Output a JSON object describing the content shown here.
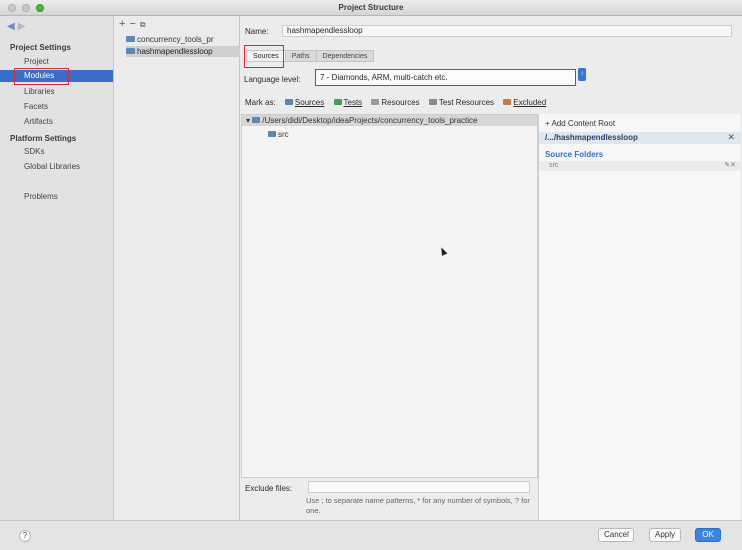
{
  "window": {
    "title": "Project Structure"
  },
  "sidebar": {
    "section_project": "Project Settings",
    "items_project": [
      {
        "label": "Project"
      },
      {
        "label": "Modules",
        "selected": true
      },
      {
        "label": "Libraries"
      },
      {
        "label": "Facets"
      },
      {
        "label": "Artifacts"
      }
    ],
    "section_platform": "Platform Settings",
    "items_platform": [
      {
        "label": "SDKs"
      },
      {
        "label": "Global Libraries"
      }
    ],
    "problems": "Problems"
  },
  "modules": {
    "items": [
      {
        "label": "concurrency_tools_pr"
      },
      {
        "label": "hashmapendlessloop",
        "selected": true
      }
    ]
  },
  "main": {
    "name_label": "Name:",
    "name_value": "hashmapendlessloop",
    "tabs": [
      {
        "label": "Sources",
        "active": true
      },
      {
        "label": "Paths"
      },
      {
        "label": "Dependencies"
      }
    ],
    "language_level_label": "Language level:",
    "language_level_value": "7 - Diamonds, ARM, multi-catch etc.",
    "mark_as_label": "Mark as:",
    "mark_as": {
      "sources": "Sources",
      "tests": "Tests",
      "resources": "Resources",
      "test_resources": "Test Resources",
      "excluded": "Excluded"
    },
    "tree_root": "/Users/didi/Desktop/ideaProjects/concurrency_tools_practice",
    "tree_child": "src",
    "exclude_label": "Exclude files:",
    "exclude_help": "Use ; to separate name patterns, * for any number of symbols, ? for one."
  },
  "roots_panel": {
    "add_content_root": "+ Add Content Root",
    "root_path": "/.../hashmapendlessloop",
    "source_folders_title": "Source Folders",
    "source_folder": "src"
  },
  "footer": {
    "help": "?",
    "cancel": "Cancel",
    "apply": "Apply",
    "ok": "OK"
  },
  "colors": {
    "selection": "#3b6cc7",
    "highlight_box": "#d22a3a",
    "ok_button": "#3d84e0"
  }
}
